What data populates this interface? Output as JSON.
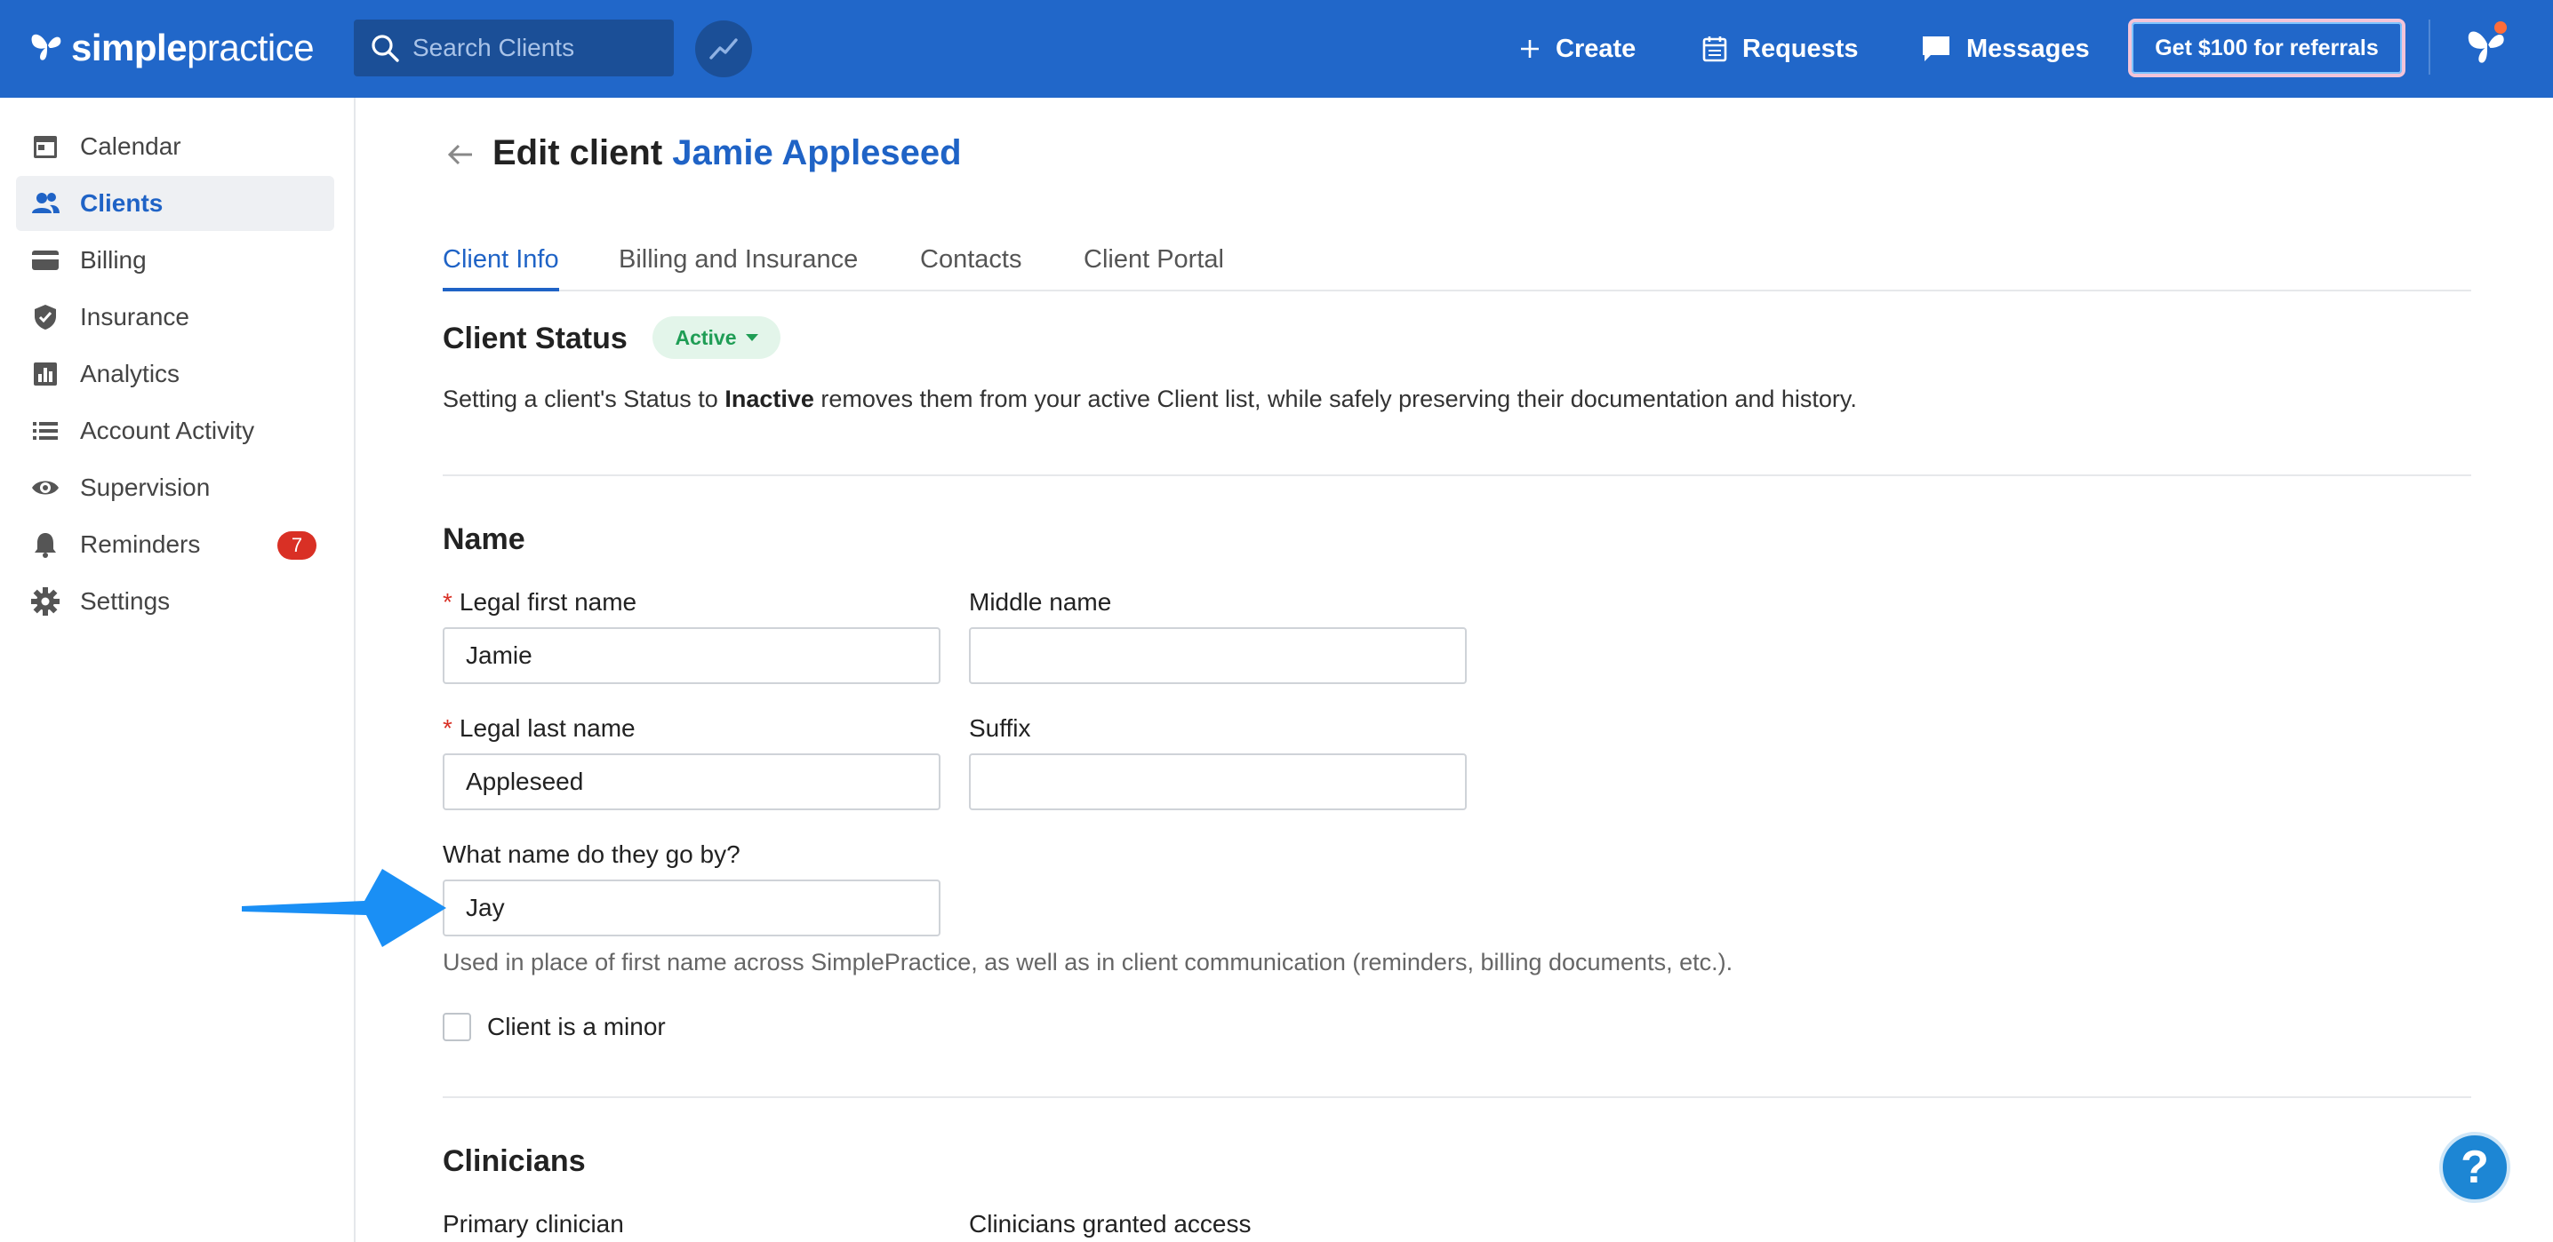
{
  "app": {
    "brand_bold": "simple",
    "brand_light": "practice",
    "brand_color": "#2167c9"
  },
  "topbar": {
    "search_placeholder": "Search Clients",
    "create_label": "Create",
    "requests_label": "Requests",
    "messages_label": "Messages",
    "referral_label": "Get $100 for referrals"
  },
  "sidebar": {
    "items": [
      {
        "label": "Calendar",
        "icon": "calendar-icon"
      },
      {
        "label": "Clients",
        "icon": "clients-icon",
        "active": true
      },
      {
        "label": "Billing",
        "icon": "billing-card-icon"
      },
      {
        "label": "Insurance",
        "icon": "shield-check-icon"
      },
      {
        "label": "Analytics",
        "icon": "analytics-icon"
      },
      {
        "label": "Account Activity",
        "icon": "list-icon"
      },
      {
        "label": "Supervision",
        "icon": "eye-icon"
      },
      {
        "label": "Reminders",
        "icon": "bell-icon",
        "badge": "7"
      },
      {
        "label": "Settings",
        "icon": "gear-icon"
      }
    ]
  },
  "page": {
    "title_prefix": "Edit client",
    "client_name": "Jamie Appleseed"
  },
  "tabs": [
    {
      "label": "Client Info",
      "active": true
    },
    {
      "label": "Billing and Insurance"
    },
    {
      "label": "Contacts"
    },
    {
      "label": "Client Portal"
    }
  ],
  "client_status": {
    "heading": "Client Status",
    "status": "Active",
    "desc_before": "Setting a client's Status to ",
    "desc_bold": "Inactive",
    "desc_after": " removes them from your active Client list, while safely preserving their documentation and history."
  },
  "name_section": {
    "heading": "Name",
    "first_name_label": "Legal first name",
    "first_name_value": "Jamie",
    "middle_name_label": "Middle name",
    "middle_name_value": "",
    "last_name_label": "Legal last name",
    "last_name_value": "Appleseed",
    "suffix_label": "Suffix",
    "suffix_value": "",
    "goes_by_label": "What name do they go by?",
    "goes_by_value": "Jay",
    "goes_by_help": "Used in place of first name across SimplePractice, as well as in client communication (reminders, billing documents, etc.).",
    "minor_label": "Client is a minor",
    "required_mark": "*"
  },
  "clinicians_section": {
    "heading": "Clinicians",
    "primary_label": "Primary clinician",
    "granted_label": "Clinicians granted access"
  },
  "help_button": "?"
}
